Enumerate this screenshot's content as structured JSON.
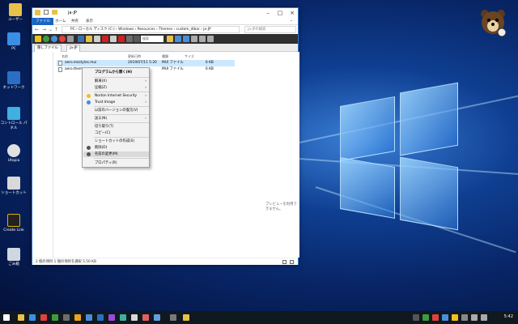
{
  "desktop_icons": [
    {
      "label": "ユーザー"
    },
    {
      "label": "PC"
    },
    {
      "label": "ネットワーク"
    },
    {
      "label": "コントロール パネル"
    },
    {
      "label": "Utopia"
    },
    {
      "label": "ショートカット"
    },
    {
      "label": "Create Link"
    },
    {
      "label": "ごみ箱"
    }
  ],
  "window": {
    "title": "ja-JP",
    "ribbon_tabs": [
      "ファイル",
      "ホーム",
      "共有",
      "表示"
    ],
    "address_path": "PC › ローカル ディスク (C:) › Windows › Resources › Themes › custom_dlbar › ja-JP",
    "search_placeholder": "ja-JPの検索",
    "toolbar_search": "検索",
    "folder_tabs": [
      "隠しファイル",
      "ja-JP"
    ],
    "columns": [
      "名前",
      "更新日時",
      "種類",
      "サイズ"
    ],
    "files": [
      {
        "name": "aero.msstyles.mui",
        "date": "2019/07/11 5:20",
        "type": "MUI ファイル",
        "size": "6 KB",
        "selected": true
      },
      {
        "name": "aero.theme",
        "date": "",
        "type": "MUI ファイル",
        "size": "6 KB",
        "selected": false
      }
    ],
    "preview_text": "プレビューを利用できません。",
    "status": "2 個の項目   1 個の項目を選択  5.50 KB"
  },
  "context_menu": {
    "items": [
      {
        "label": "プログラムから開く(H)",
        "bold": true
      },
      {
        "label": "解凍(X)",
        "arrow": true
      },
      {
        "label": "圧縮(Z)",
        "arrow": true
      },
      {
        "label": "Norton Internet Security",
        "arrow": true
      },
      {
        "label": "Trust Image",
        "arrow": true
      },
      {
        "label": "以前のバージョンの復元(V)"
      },
      {
        "label": "送る(N)",
        "arrow": true
      },
      {
        "label": "切り取り(T)"
      },
      {
        "label": "コピー(C)"
      },
      {
        "label": "ショートカットの作成(S)"
      },
      {
        "label": "削除(D)"
      },
      {
        "label": "名前の変更(M)"
      },
      {
        "label": "プロパティ(R)"
      }
    ]
  },
  "taskbar": {
    "time": "5:42"
  },
  "colors": {
    "accent": "#1b65c0",
    "selection": "#cce8ff",
    "taskbar": "#101820"
  }
}
